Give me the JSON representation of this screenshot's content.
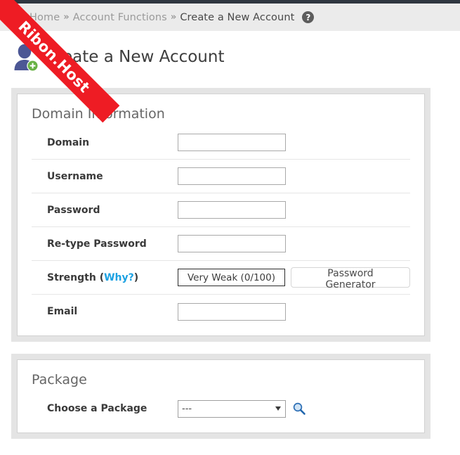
{
  "window": {
    "title": "Create a New Account",
    "top_bar_color": "#2f3640",
    "accent_link_color": "#1ba1e2"
  },
  "breadcrumb": {
    "menu_icon": "hamburger-menu-icon",
    "items": [
      {
        "label": "Home",
        "current": false
      },
      {
        "label": "Account Functions",
        "current": false
      },
      {
        "label": "Create a New Account",
        "current": true
      }
    ],
    "separator": "»",
    "help_icon_label": "?"
  },
  "page_header": {
    "icon": "user-add-icon",
    "title": "Create a New Account"
  },
  "watermark": {
    "text": "Ribon.Host",
    "color": "#ee1c24"
  },
  "domain_section": {
    "title": "Domain Information",
    "rows": [
      {
        "label": "Domain",
        "type": "text",
        "value": "",
        "placeholder": ""
      },
      {
        "label": "Username",
        "type": "text",
        "value": "",
        "placeholder": ""
      },
      {
        "label": "Password",
        "type": "text",
        "value": "",
        "placeholder": ""
      },
      {
        "label": "Re-type Password",
        "type": "text",
        "value": "",
        "placeholder": ""
      },
      {
        "label": "Strength",
        "type": "strength"
      },
      {
        "label": "Email",
        "type": "text",
        "value": "",
        "placeholder": ""
      }
    ],
    "strength": {
      "label_prefix": "Strength",
      "why_link": "Why?",
      "value": "Very Weak (0/100)",
      "score": 0,
      "score_max": 100,
      "generator_button": "Password Generator"
    }
  },
  "package_section": {
    "title": "Package",
    "row_label": "Choose a Package",
    "select_value": "---",
    "select_options": [
      "---"
    ],
    "search_icon": "magnifier-search-icon"
  }
}
